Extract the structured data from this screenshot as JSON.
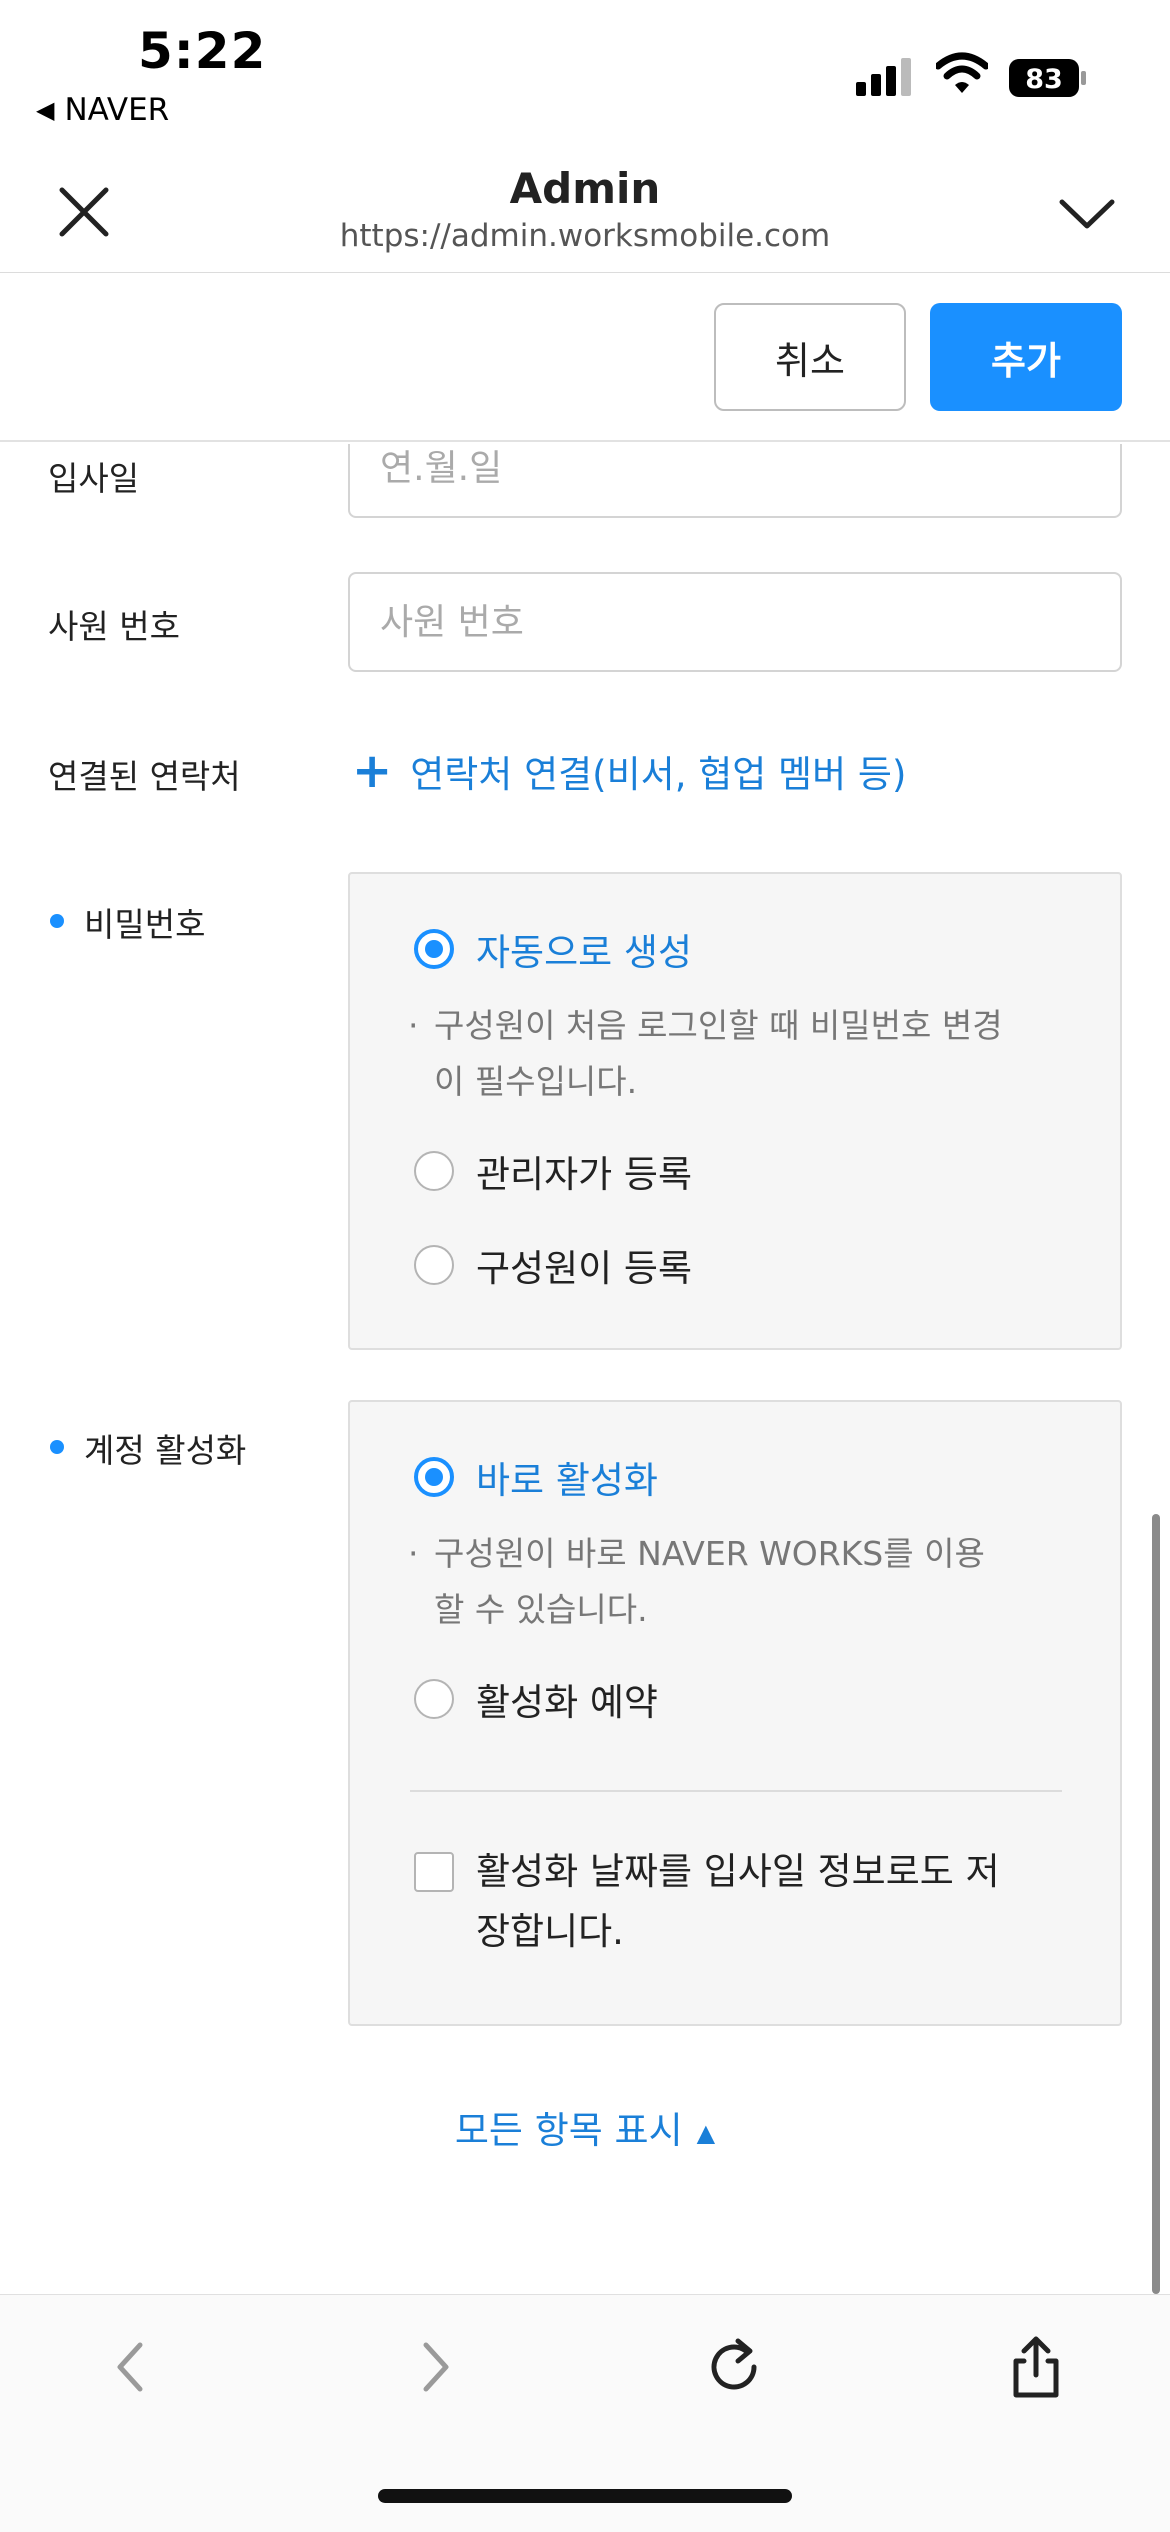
{
  "status": {
    "time": "5:22",
    "back_app": "NAVER",
    "battery": "83"
  },
  "nav": {
    "title": "Admin",
    "url": "https://admin.worksmobile.com"
  },
  "actions": {
    "cancel_label": "취소",
    "add_label": "추가"
  },
  "form": {
    "hire_date": {
      "label": "입사일",
      "placeholder": "연.월.일"
    },
    "employee_no": {
      "label": "사원 번호",
      "placeholder": "사원 번호"
    },
    "contacts": {
      "label": "연결된 연락처",
      "link": "연락처 연결(비서, 협업 멤버 등)"
    },
    "password": {
      "label": "비밀번호",
      "options": [
        {
          "label": "자동으로 생성",
          "selected": true
        },
        {
          "label": "관리자가 등록",
          "selected": false
        },
        {
          "label": "구성원이 등록",
          "selected": false
        }
      ],
      "note_line1": "구성원이 처음 로그인할 때 비밀번호 변경",
      "note_line2": "이 필수입니다."
    },
    "activation": {
      "label": "계정 활성화",
      "options": [
        {
          "label": "바로 활성화",
          "selected": true
        },
        {
          "label": "활성화 예약",
          "selected": false
        }
      ],
      "note_line1": "구성원이 바로 NAVER WORKS를 이용",
      "note_line2": "할 수 있습니다.",
      "checkbox_line1": "활성화 날짜를 입사일 정보로도 저",
      "checkbox_line2": "장합니다.",
      "checkbox_checked": false
    },
    "show_all": "모든 항목 표시"
  },
  "colors": {
    "accent": "#1a90ff",
    "link": "#1a7fd8"
  },
  "icons": {
    "close": "close-icon",
    "chevron": "chevron-down-icon",
    "back": "back-arrow-icon",
    "forward": "forward-arrow-icon",
    "reload": "reload-icon",
    "share": "share-icon"
  }
}
